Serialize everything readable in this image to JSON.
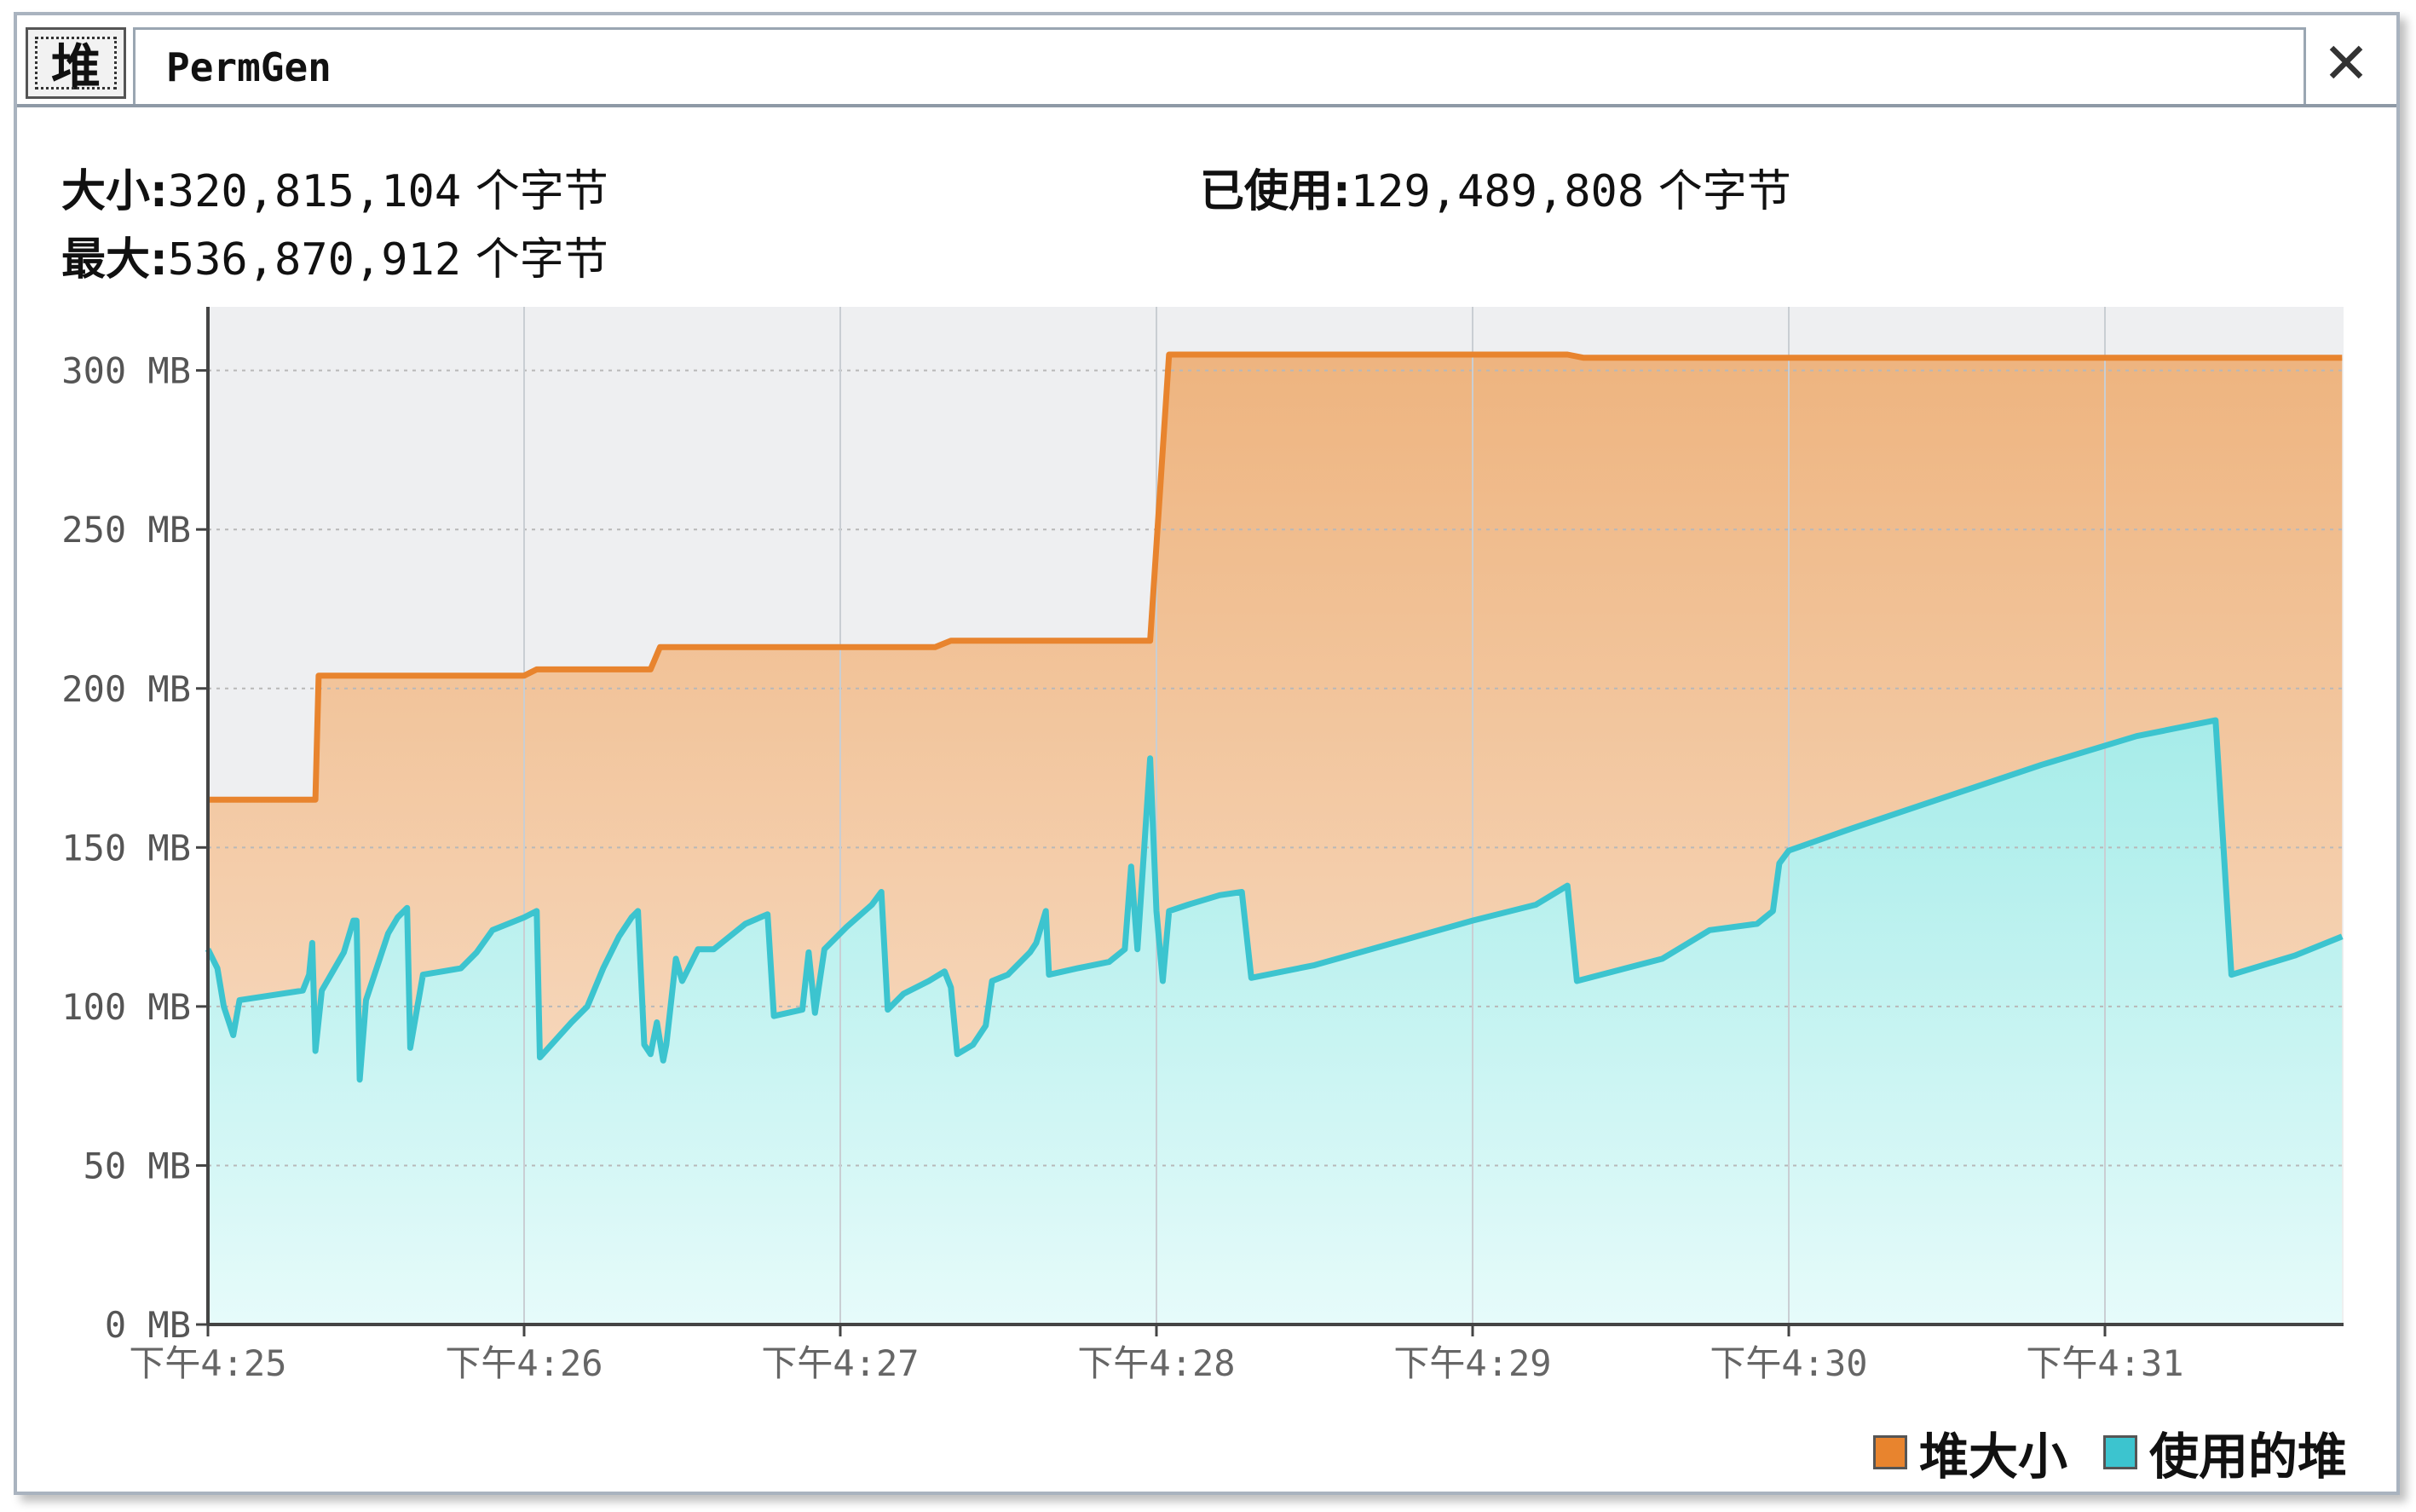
{
  "tabs": [
    {
      "label": "堆",
      "active": true
    },
    {
      "label": "PermGen",
      "active": false
    }
  ],
  "close_label": "✕",
  "stats": {
    "size_key": "大小:",
    "size_value": "320,815,104",
    "max_key": "最大:",
    "max_value": "536,870,912",
    "used_key": "已使用:",
    "used_value": "129,489,808",
    "unit": "个字节"
  },
  "colors": {
    "heap_size": "#e8842e",
    "used_heap": "#3cc4cf",
    "plot_bg": "#eeeff1",
    "grid": "#c8c8c8"
  },
  "chart_data": {
    "type": "area",
    "title": "",
    "xlabel": "",
    "ylabel": "",
    "ylim": [
      0,
      320
    ],
    "y_ticks": [
      "0 MB",
      "50 MB",
      "100 MB",
      "150 MB",
      "200 MB",
      "250 MB",
      "300 MB"
    ],
    "x_ticks": [
      "下午4:25",
      "下午4:26",
      "下午4:27",
      "下午4:28",
      "下午4:29",
      "下午4:30",
      "下午4:31"
    ],
    "grid": true,
    "legend_position": "bottom-right",
    "series": [
      {
        "name": "堆大小",
        "color": "#e8842e",
        "points": [
          [
            0,
            165
          ],
          [
            0.34,
            165
          ],
          [
            0.35,
            204
          ],
          [
            1.0,
            204
          ],
          [
            1.04,
            206
          ],
          [
            1.4,
            206
          ],
          [
            1.43,
            213
          ],
          [
            2.3,
            213
          ],
          [
            2.35,
            215
          ],
          [
            2.98,
            215
          ],
          [
            3.04,
            305
          ],
          [
            4.3,
            305
          ],
          [
            4.35,
            304
          ],
          [
            6.75,
            304
          ]
        ]
      },
      {
        "name": "使用的堆",
        "color": "#3cc4cf",
        "points": [
          [
            0,
            118
          ],
          [
            0.03,
            112
          ],
          [
            0.05,
            100
          ],
          [
            0.08,
            91
          ],
          [
            0.1,
            102
          ],
          [
            0.3,
            105
          ],
          [
            0.32,
            110
          ],
          [
            0.33,
            120
          ],
          [
            0.34,
            86
          ],
          [
            0.36,
            105
          ],
          [
            0.43,
            117
          ],
          [
            0.46,
            127
          ],
          [
            0.47,
            127
          ],
          [
            0.48,
            77
          ],
          [
            0.5,
            102
          ],
          [
            0.57,
            123
          ],
          [
            0.6,
            128
          ],
          [
            0.63,
            131
          ],
          [
            0.64,
            87
          ],
          [
            0.68,
            110
          ],
          [
            0.8,
            112
          ],
          [
            0.85,
            117
          ],
          [
            0.9,
            124
          ],
          [
            1.0,
            128
          ],
          [
            1.04,
            130
          ],
          [
            1.05,
            84
          ],
          [
            1.15,
            95
          ],
          [
            1.2,
            100
          ],
          [
            1.25,
            112
          ],
          [
            1.3,
            122
          ],
          [
            1.34,
            128
          ],
          [
            1.36,
            130
          ],
          [
            1.38,
            88
          ],
          [
            1.4,
            85
          ],
          [
            1.42,
            95
          ],
          [
            1.44,
            83
          ],
          [
            1.45,
            88
          ],
          [
            1.48,
            115
          ],
          [
            1.5,
            108
          ],
          [
            1.55,
            118
          ],
          [
            1.6,
            118
          ],
          [
            1.65,
            122
          ],
          [
            1.7,
            126
          ],
          [
            1.77,
            129
          ],
          [
            1.79,
            97
          ],
          [
            1.88,
            99
          ],
          [
            1.9,
            117
          ],
          [
            1.92,
            98
          ],
          [
            1.95,
            118
          ],
          [
            2.02,
            125
          ],
          [
            2.1,
            132
          ],
          [
            2.13,
            136
          ],
          [
            2.15,
            99
          ],
          [
            2.2,
            104
          ],
          [
            2.28,
            108
          ],
          [
            2.33,
            111
          ],
          [
            2.35,
            106
          ],
          [
            2.37,
            85
          ],
          [
            2.42,
            88
          ],
          [
            2.46,
            94
          ],
          [
            2.48,
            108
          ],
          [
            2.53,
            110
          ],
          [
            2.6,
            117
          ],
          [
            2.62,
            120
          ],
          [
            2.65,
            130
          ],
          [
            2.66,
            110
          ],
          [
            2.75,
            112
          ],
          [
            2.85,
            114
          ],
          [
            2.9,
            118
          ],
          [
            2.92,
            144
          ],
          [
            2.94,
            118
          ],
          [
            2.96,
            148
          ],
          [
            2.98,
            178
          ],
          [
            3.0,
            130
          ],
          [
            3.02,
            108
          ],
          [
            3.04,
            130
          ],
          [
            3.1,
            132
          ],
          [
            3.2,
            135
          ],
          [
            3.27,
            136
          ],
          [
            3.3,
            109
          ],
          [
            3.5,
            113
          ],
          [
            3.75,
            120
          ],
          [
            4.0,
            127
          ],
          [
            4.2,
            132
          ],
          [
            4.3,
            138
          ],
          [
            4.33,
            108
          ],
          [
            4.6,
            115
          ],
          [
            4.75,
            124
          ],
          [
            4.9,
            126
          ],
          [
            4.95,
            130
          ],
          [
            4.97,
            145
          ],
          [
            5.0,
            149
          ],
          [
            5.2,
            156
          ],
          [
            5.5,
            166
          ],
          [
            5.8,
            176
          ],
          [
            6.1,
            185
          ],
          [
            6.35,
            190
          ],
          [
            6.4,
            110
          ],
          [
            6.6,
            116
          ],
          [
            6.75,
            122
          ]
        ]
      }
    ]
  }
}
